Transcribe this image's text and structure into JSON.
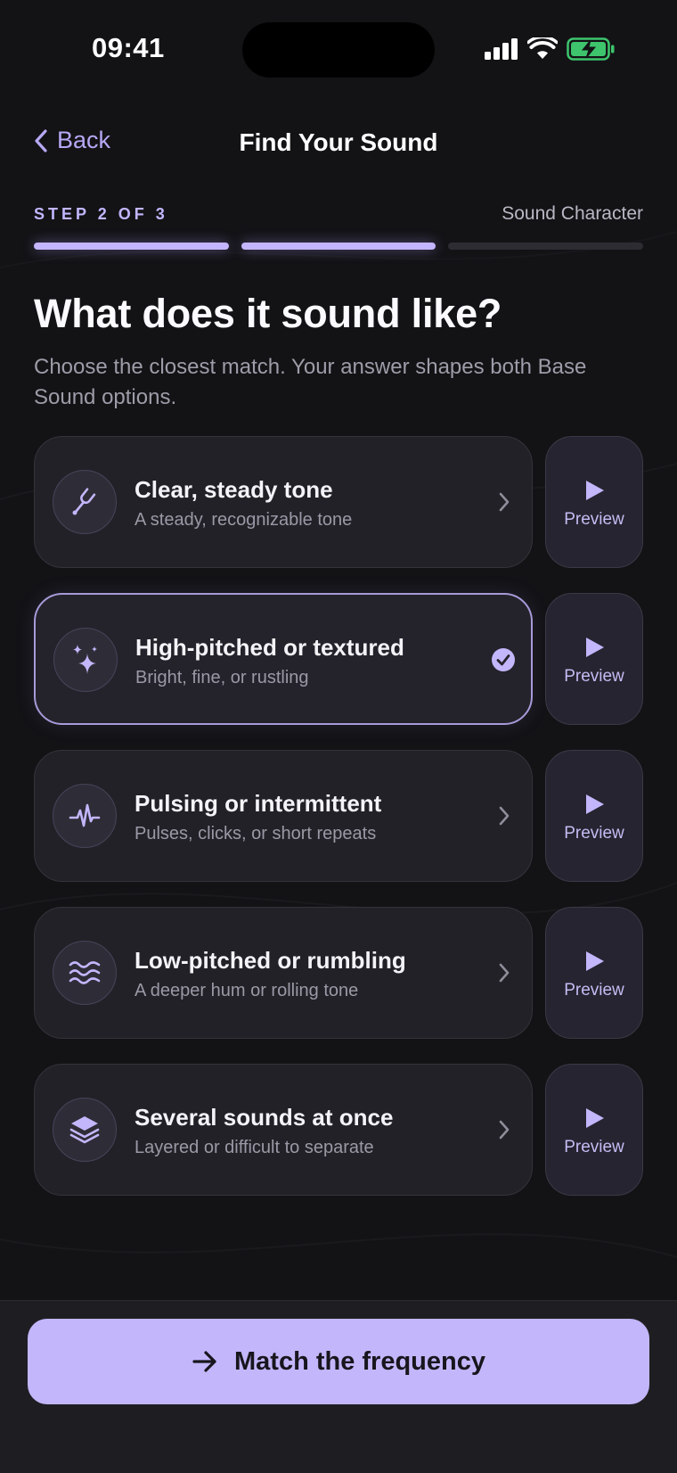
{
  "status": {
    "time": "09:41"
  },
  "nav": {
    "back_label": "Back",
    "title": "Find Your Sound"
  },
  "step": {
    "label": "STEP 2 OF 3",
    "name": "Sound Character",
    "current": 2,
    "total": 3
  },
  "headline": "What does it sound like?",
  "subtext": "Choose the closest match. Your answer shapes both Base Sound options.",
  "options": [
    {
      "title": "Clear, steady tone",
      "desc": "A steady, recognizable tone",
      "icon": "tuning-fork-icon",
      "selected": false,
      "preview_label": "Preview"
    },
    {
      "title": "High-pitched or textured",
      "desc": "Bright, fine, or rustling",
      "icon": "sparkles-icon",
      "selected": true,
      "preview_label": "Preview"
    },
    {
      "title": "Pulsing or intermittent",
      "desc": "Pulses, clicks, or short repeats",
      "icon": "pulse-wave-icon",
      "selected": false,
      "preview_label": "Preview"
    },
    {
      "title": "Low-pitched or rumbling",
      "desc": "A deeper hum or rolling tone",
      "icon": "waves-icon",
      "selected": false,
      "preview_label": "Preview"
    },
    {
      "title": "Several sounds at once",
      "desc": "Layered or difficult to separate",
      "icon": "layers-icon",
      "selected": false,
      "preview_label": "Preview"
    }
  ],
  "cta": {
    "label": "Match the frequency",
    "icon": "arrow-right-icon"
  },
  "colors": {
    "accent": "#c4b6fb",
    "background": "#131316",
    "card": "#222127",
    "battery": "#3ec46d"
  }
}
